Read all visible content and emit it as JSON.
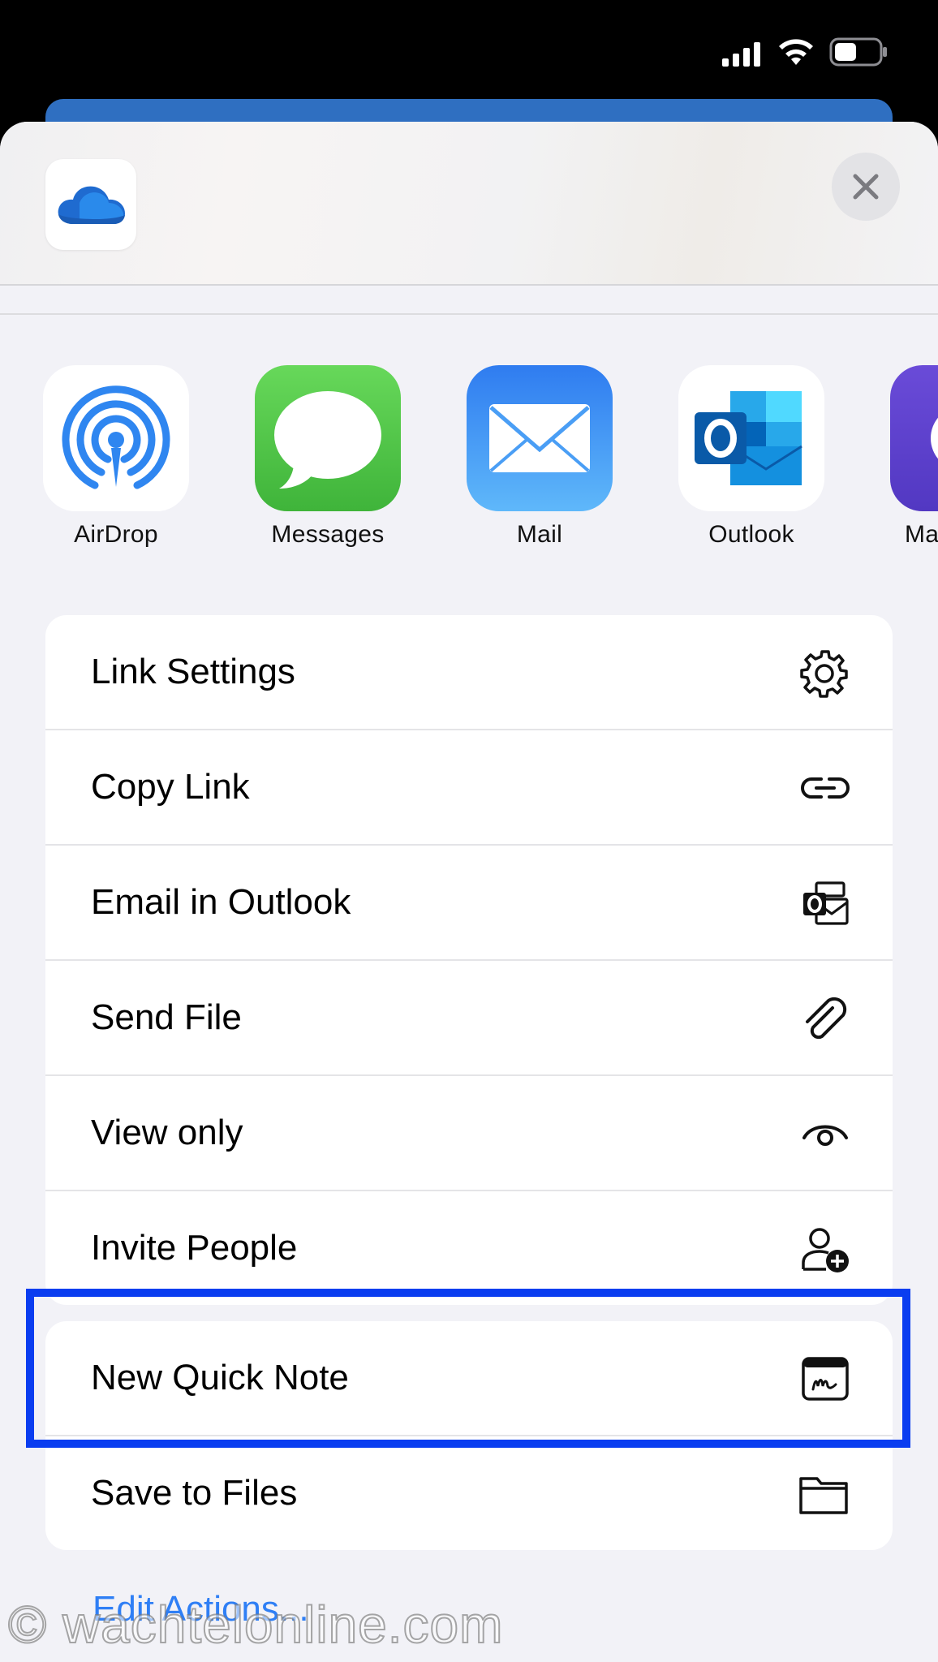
{
  "status_bar": {
    "icons": [
      "cellular-signal-icon",
      "wifi-icon",
      "battery-icon"
    ]
  },
  "sheet": {
    "header": {
      "app_icon": "onedrive-cloud-icon",
      "close_icon": "close-icon"
    },
    "share_apps": [
      {
        "label": "AirDrop",
        "icon": "airdrop-icon"
      },
      {
        "label": "Messages",
        "icon": "messages-icon"
      },
      {
        "label": "Mail",
        "icon": "mail-icon"
      },
      {
        "label": "Outlook",
        "icon": "outlook-icon"
      },
      {
        "label": "Ma",
        "icon": "partial-app-icon"
      }
    ],
    "group1": [
      {
        "label": "Link Settings",
        "icon": "gear-icon"
      },
      {
        "label": "Copy Link",
        "icon": "link-icon"
      },
      {
        "label": "Email in Outlook",
        "icon": "outlook-mail-icon"
      },
      {
        "label": "Send File",
        "icon": "paperclip-icon"
      },
      {
        "label": "View only",
        "icon": "eye-icon"
      },
      {
        "label": "Invite People",
        "icon": "person-add-icon"
      }
    ],
    "group2": [
      {
        "label": "New Quick Note",
        "icon": "quick-note-icon"
      },
      {
        "label": "Save to Files",
        "icon": "folder-icon"
      }
    ],
    "edit_actions": "Edit Actions...",
    "watermark": "© wachtelonline.com"
  },
  "colors": {
    "highlight": "#0a3df0",
    "link_blue": "#2f7ff5",
    "messages_green": "#5ac84d",
    "mail_blue": "#3d8ff5",
    "airdrop_blue": "#2f86f0"
  }
}
